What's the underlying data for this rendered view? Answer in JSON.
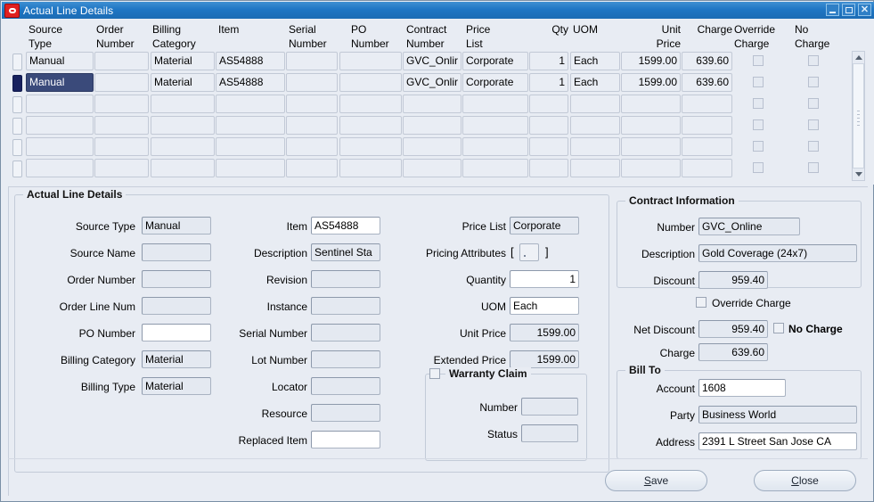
{
  "window": {
    "title": "Actual Line Details",
    "icon": "oracle-logo-icon",
    "controls": {
      "minimize": "–",
      "maximize": "□",
      "close": "×"
    }
  },
  "grid": {
    "columns": [
      {
        "key": "source_type",
        "header": "Source\nType",
        "align": "left"
      },
      {
        "key": "order_number",
        "header": "Order\nNumber",
        "align": "left"
      },
      {
        "key": "billing_category",
        "header": "Billing\nCategory",
        "align": "left"
      },
      {
        "key": "item",
        "header": "Item",
        "align": "left"
      },
      {
        "key": "serial_number",
        "header": "Serial\nNumber",
        "align": "left"
      },
      {
        "key": "po_number",
        "header": "PO\nNumber",
        "align": "left"
      },
      {
        "key": "contract_number",
        "header": "Contract\nNumber",
        "align": "left"
      },
      {
        "key": "price_list",
        "header": "Price\nList",
        "align": "left"
      },
      {
        "key": "qty",
        "header": "Qty",
        "align": "right"
      },
      {
        "key": "uom",
        "header": "UOM",
        "align": "left"
      },
      {
        "key": "unit_price",
        "header": "Unit\nPrice",
        "align": "right"
      },
      {
        "key": "charge",
        "header": "Charge",
        "align": "right"
      },
      {
        "key": "override_charge",
        "header": "Override\nCharge",
        "align": "center"
      },
      {
        "key": "no_charge",
        "header": "No\nCharge",
        "align": "center"
      }
    ],
    "rows": [
      {
        "selected": false,
        "source_type": "Manual",
        "order_number": "",
        "billing_category": "Material",
        "item": "AS54888",
        "serial_number": "",
        "po_number": "",
        "contract_number": "GVC_Onlir",
        "price_list": "Corporate",
        "qty": "1",
        "uom": "Each",
        "unit_price": "1599.00",
        "charge": "639.60",
        "override_charge": false,
        "no_charge": false
      },
      {
        "selected": true,
        "source_type": "Manual",
        "order_number": "",
        "billing_category": "Material",
        "item": "AS54888",
        "serial_number": "",
        "po_number": "",
        "contract_number": "GVC_Onlir",
        "price_list": "Corporate",
        "qty": "1",
        "uom": "Each",
        "unit_price": "1599.00",
        "charge": "639.60",
        "override_charge": false,
        "no_charge": false
      },
      {
        "selected": false,
        "source_type": "",
        "order_number": "",
        "billing_category": "",
        "item": "",
        "serial_number": "",
        "po_number": "",
        "contract_number": "",
        "price_list": "",
        "qty": "",
        "uom": "",
        "unit_price": "",
        "charge": "",
        "override_charge": false,
        "no_charge": false
      },
      {
        "selected": false,
        "source_type": "",
        "order_number": "",
        "billing_category": "",
        "item": "",
        "serial_number": "",
        "po_number": "",
        "contract_number": "",
        "price_list": "",
        "qty": "",
        "uom": "",
        "unit_price": "",
        "charge": "",
        "override_charge": false,
        "no_charge": false
      },
      {
        "selected": false,
        "source_type": "",
        "order_number": "",
        "billing_category": "",
        "item": "",
        "serial_number": "",
        "po_number": "",
        "contract_number": "",
        "price_list": "",
        "qty": "",
        "uom": "",
        "unit_price": "",
        "charge": "",
        "override_charge": false,
        "no_charge": false
      },
      {
        "selected": false,
        "source_type": "",
        "order_number": "",
        "billing_category": "",
        "item": "",
        "serial_number": "",
        "po_number": "",
        "contract_number": "",
        "price_list": "",
        "qty": "",
        "uom": "",
        "unit_price": "",
        "charge": "",
        "override_charge": false,
        "no_charge": false
      }
    ]
  },
  "detail": {
    "title": "Actual Line Details",
    "left_column": {
      "source_type": {
        "label": "Source Type",
        "value": "Manual",
        "editable": false
      },
      "source_name": {
        "label": "Source Name",
        "value": "",
        "editable": false
      },
      "order_number": {
        "label": "Order Number",
        "value": "",
        "editable": false
      },
      "order_line_num": {
        "label": "Order Line Num",
        "value": "",
        "editable": false
      },
      "po_number": {
        "label": "PO Number",
        "value": "",
        "editable": true
      },
      "billing_category": {
        "label": "Billing Category",
        "value": "Material",
        "editable": false
      },
      "billing_type": {
        "label": "Billing Type",
        "value": "Material",
        "editable": false
      }
    },
    "middle_column": {
      "item": {
        "label": "Item",
        "value": "AS54888",
        "editable": true
      },
      "description": {
        "label": "Description",
        "value": "Sentinel Sta",
        "editable": false
      },
      "revision": {
        "label": "Revision",
        "value": "",
        "editable": false
      },
      "instance": {
        "label": "Instance",
        "value": "",
        "editable": false
      },
      "serial_number": {
        "label": "Serial Number",
        "value": "",
        "editable": false
      },
      "lot_number": {
        "label": "Lot Number",
        "value": "",
        "editable": false
      },
      "locator": {
        "label": "Locator",
        "value": "",
        "editable": false
      },
      "resource": {
        "label": "Resource",
        "value": "",
        "editable": false
      },
      "replaced_item": {
        "label": "Replaced Item",
        "value": "",
        "editable": true
      }
    },
    "pricing_column": {
      "price_list": {
        "label": "Price List",
        "value": "Corporate",
        "editable": false
      },
      "pricing_attributes": {
        "label": "Pricing Attributes",
        "open_bracket": "[",
        "close_bracket": "]"
      },
      "quantity": {
        "label": "Quantity",
        "value": "1",
        "editable": true
      },
      "uom": {
        "label": "UOM",
        "value": "Each",
        "editable": true
      },
      "unit_price": {
        "label": "Unit Price",
        "value": "1599.00",
        "editable": false
      },
      "extended_price": {
        "label": "Extended Price",
        "value": "1599.00",
        "editable": false
      }
    },
    "warranty_claim": {
      "title": "Warranty Claim",
      "checked": false,
      "number": {
        "label": "Number",
        "value": "",
        "editable": false
      },
      "status": {
        "label": "Status",
        "value": "",
        "editable": false
      }
    },
    "contract_information": {
      "title": "Contract Information",
      "number": {
        "label": "Number",
        "value": "GVC_Online",
        "editable": false
      },
      "description": {
        "label": "Description",
        "value": "Gold Coverage (24x7)",
        "editable": false
      },
      "discount": {
        "label": "Discount",
        "value": "959.40",
        "editable": false
      }
    },
    "charges": {
      "override_charge": {
        "label": "Override Charge",
        "checked": false
      },
      "no_charge": {
        "label": "No Charge",
        "checked": false
      },
      "net_discount": {
        "label": "Net Discount",
        "value": "959.40",
        "editable": false
      },
      "charge": {
        "label": "Charge",
        "value": "639.60",
        "editable": false
      }
    },
    "bill_to": {
      "title": "Bill To",
      "account": {
        "label": "Account",
        "value": "1608",
        "editable": true
      },
      "party": {
        "label": "Party",
        "value": "Business World",
        "editable": false
      },
      "address": {
        "label": "Address",
        "value": "2391 L Street   San Jose CA",
        "editable": true
      }
    }
  },
  "footer": {
    "save": {
      "label": "Save",
      "mnemonic": "S"
    },
    "close": {
      "label": "Close",
      "mnemonic": "C"
    }
  }
}
